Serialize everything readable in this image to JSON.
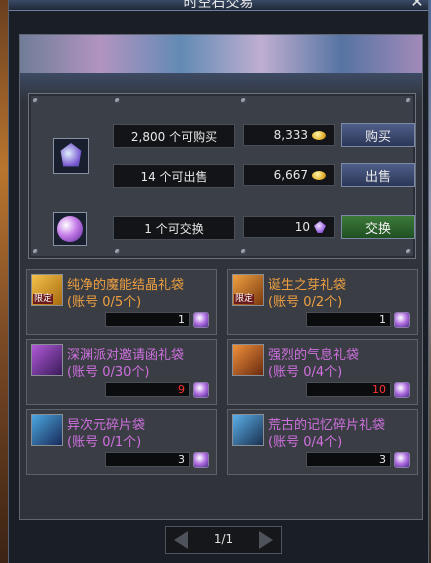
{
  "window": {
    "title": "时空石交易"
  },
  "trade": {
    "crystal": {
      "buy_text": "2,800 个可购买",
      "sell_text": "14 个可出售",
      "buy_price": "8,333",
      "sell_price": "6,667",
      "buy_label": "购买",
      "sell_label": "出售"
    },
    "orb": {
      "exchange_text": "1 个可交换",
      "exchange_cost": "10",
      "exchange_label": "交换"
    }
  },
  "items": [
    {
      "name": "纯净的魔能结晶礼袋",
      "limit": "(账号 0/5个)",
      "qty": "1",
      "limited_tag": "限定",
      "qty_red": false,
      "color": "orange"
    },
    {
      "name": "诞生之芽礼袋",
      "limit": "(账号 0/2个)",
      "qty": "1",
      "limited_tag": "限定",
      "qty_red": false,
      "color": "orange"
    },
    {
      "name": "深渊派对邀请函礼袋",
      "limit": "(账号 0/30个)",
      "qty": "9",
      "limited_tag": "",
      "qty_red": true,
      "color": "purple"
    },
    {
      "name": "强烈的气息礼袋",
      "limit": "(账号 0/4个)",
      "qty": "10",
      "limited_tag": "",
      "qty_red": true,
      "color": "purple"
    },
    {
      "name": "异次元碎片袋",
      "limit": "(账号 0/1个)",
      "qty": "3",
      "limited_tag": "",
      "qty_red": false,
      "color": "purple"
    },
    {
      "name": "荒古的记忆碎片礼袋",
      "limit": "(账号 0/4个)",
      "qty": "3",
      "limited_tag": "",
      "qty_red": false,
      "color": "purple"
    }
  ],
  "pager": {
    "label": "1/1"
  },
  "colors": {
    "orange": "#f0a040",
    "purple": "#d070e0",
    "accent_blue": "#4f5f89",
    "accent_green": "#3d7a3a"
  }
}
